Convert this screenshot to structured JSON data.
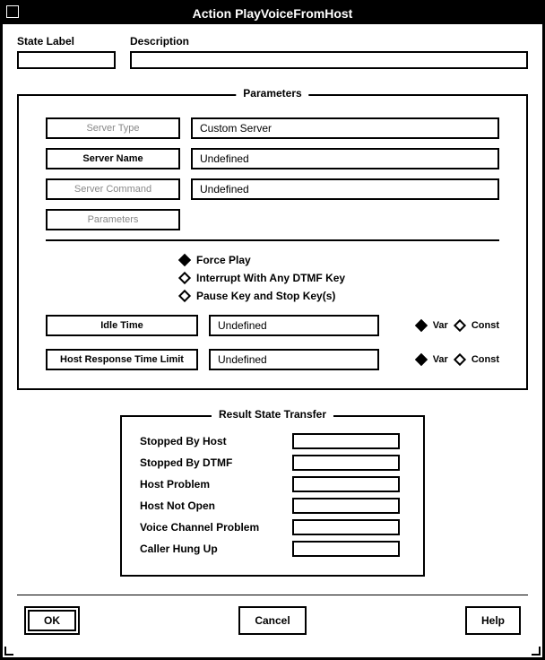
{
  "window": {
    "title": "Action PlayVoiceFromHost"
  },
  "top": {
    "state_label_text": "State Label",
    "description_text": "Description",
    "state_value": "",
    "description_value": ""
  },
  "parameters": {
    "legend": "Parameters",
    "rows": [
      {
        "label": "Server Type",
        "value": "Custom Server",
        "disabled": true
      },
      {
        "label": "Server Name",
        "value": "Undefined",
        "disabled": false
      },
      {
        "label": "Server Command",
        "value": "Undefined",
        "disabled": true
      },
      {
        "label": "Parameters",
        "value": null,
        "disabled": true
      }
    ],
    "checks": [
      {
        "label": "Force Play",
        "checked": true
      },
      {
        "label": "Interrupt With Any DTMF Key",
        "checked": false
      },
      {
        "label": "Pause Key and Stop Key(s)",
        "checked": false
      }
    ],
    "time_rows": [
      {
        "label": "Idle Time",
        "value": "Undefined",
        "var_selected": true
      },
      {
        "label": "Host Response Time Limit",
        "value": "Undefined",
        "var_selected": true
      }
    ],
    "var_label": "Var",
    "const_label": "Const"
  },
  "result": {
    "legend": "Result State Transfer",
    "rows": [
      {
        "label": "Stopped By Host",
        "value": ""
      },
      {
        "label": "Stopped By DTMF",
        "value": ""
      },
      {
        "label": "Host Problem",
        "value": ""
      },
      {
        "label": "Host Not Open",
        "value": ""
      },
      {
        "label": "Voice Channel Problem",
        "value": ""
      },
      {
        "label": "Caller Hung Up",
        "value": ""
      }
    ]
  },
  "buttons": {
    "ok": "OK",
    "cancel": "Cancel",
    "help": "Help"
  }
}
